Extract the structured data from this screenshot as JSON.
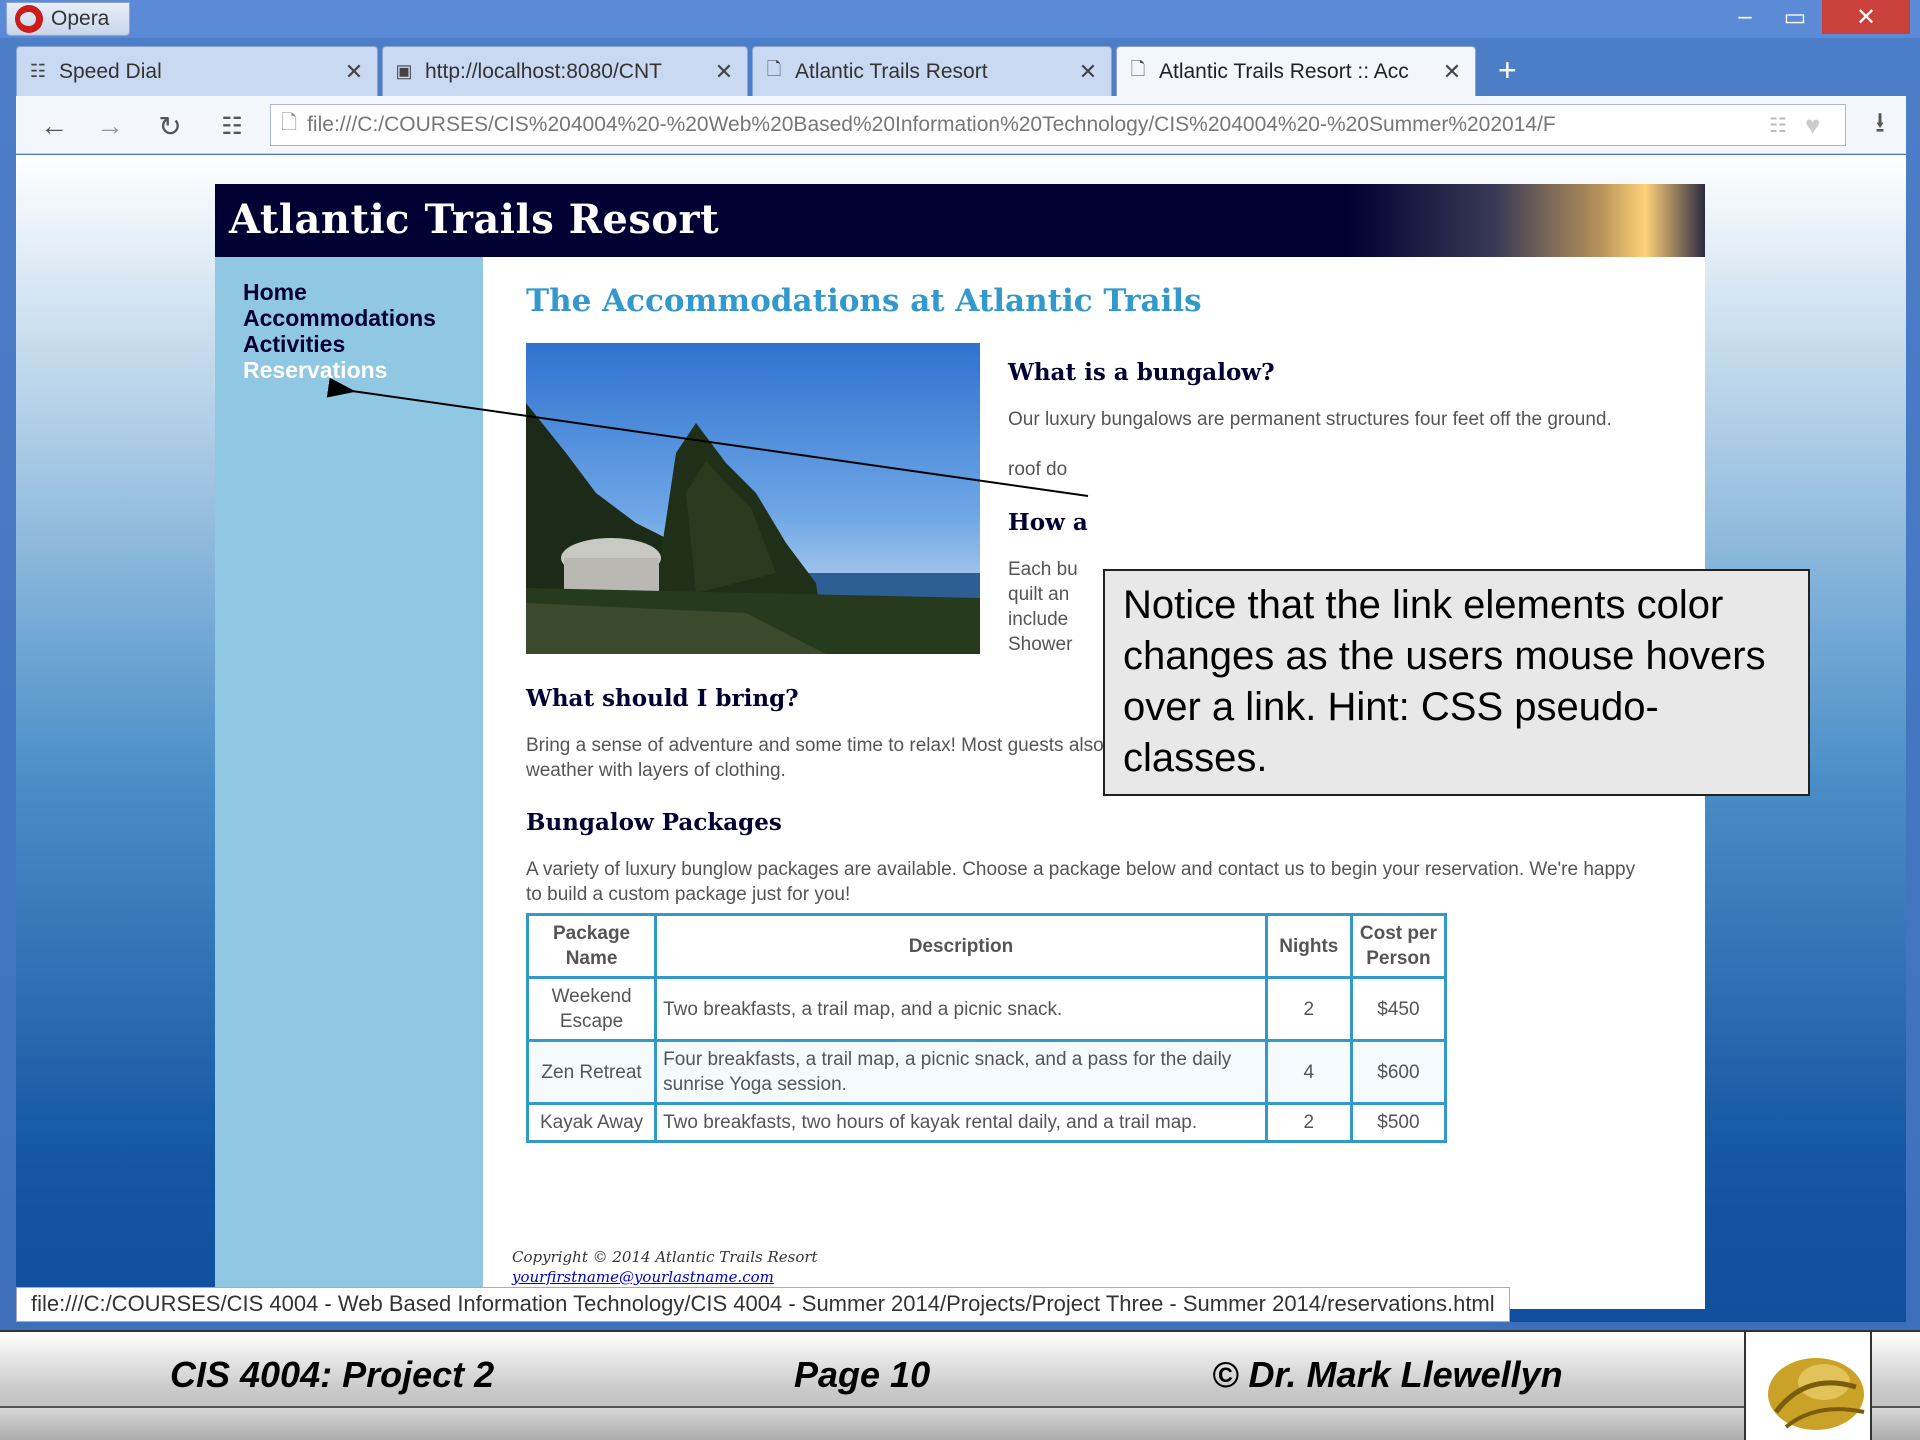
{
  "browser": {
    "app_name": "Opera",
    "tabs": [
      {
        "label": "Speed Dial",
        "icon": "speed-dial-icon"
      },
      {
        "label": "http://localhost:8080/CNT",
        "icon": "image-icon"
      },
      {
        "label": "Atlantic Trails Resort",
        "icon": "document-icon"
      },
      {
        "label": "Atlantic Trails Resort :: Acc",
        "icon": "document-icon"
      }
    ],
    "address": "file:///C:/COURSES/CIS%204004%20-%20Web%20Based%20Information%20Technology/CIS%204004%20-%20Summer%202014/F",
    "status_url": "file:///C:/COURSES/CIS 4004 - Web Based Information Technology/CIS 4004 - Summer 2014/Projects/Project Three - Summer 2014/reservations.html"
  },
  "site": {
    "title": "Atlantic Trails Resort",
    "nav": [
      "Home",
      "Accommodations",
      "Activities",
      "Reservations"
    ],
    "page_title": "The Accommodations at Atlantic Trails",
    "h_bungalow": "What is a bungalow?",
    "p_bungalow": "Our luxury bungalows are permanent structures four feet off the ground.",
    "p_bungalow_2": "roof do",
    "h_how": "How a",
    "p_each": [
      "Each bu",
      "quilt an",
      "include",
      "Shower"
    ],
    "h_bring": "What should I bring?",
    "p_bring": "Bring a sense of adventure and some time to relax! Most guests also pack comfortable walking shoes and plan to dress for changing weather with layers of clothing.",
    "h_packages": "Bungalow Packages",
    "p_packages": "A variety of luxury bunglow packages are available. Choose a package below and contact us to begin your reservation. We're happy to build a custom package just for you!",
    "table": {
      "headers": [
        "Package Name",
        "Description",
        "Nights",
        "Cost per Person"
      ],
      "rows": [
        [
          "Weekend Escape",
          "Two breakfasts, a trail map, and a picnic snack.",
          "2",
          "$450"
        ],
        [
          "Zen Retreat",
          "Four breakfasts, a trail map, a picnic snack, and a pass for the daily sunrise Yoga session.",
          "4",
          "$600"
        ],
        [
          "Kayak Away",
          "Two breakfasts, two hours of kayak rental daily, and a trail map.",
          "2",
          "$500"
        ]
      ]
    },
    "copyright": "Copyright © 2014 Atlantic Trails Resort",
    "email": "yourfirstname@yourlastname.com"
  },
  "callout": "Notice that the link elements color changes as the users mouse hovers over a link.  Hint: CSS pseudo-classes.",
  "slide_footer": {
    "left": "CIS 4004:  Project 2",
    "center": "Page 10",
    "right": "© Dr. Mark Llewellyn"
  },
  "colors": {
    "header_bg": "#000033",
    "sidebar_bg": "#90c7e3",
    "accent": "#3399cc",
    "close_button": "#c9413a"
  }
}
